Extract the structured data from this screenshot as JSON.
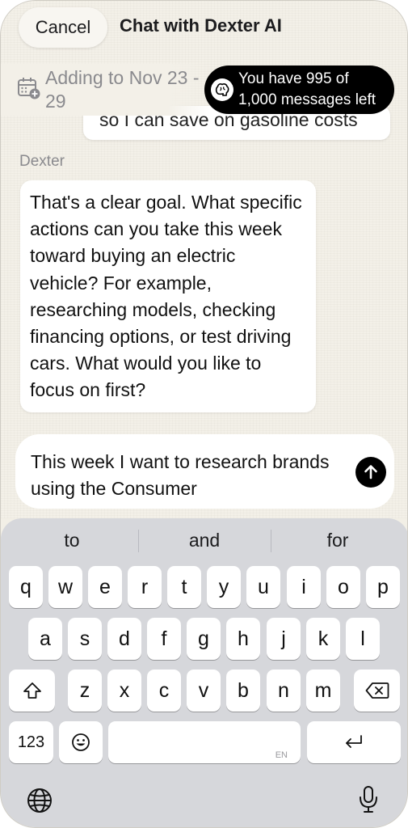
{
  "header": {
    "cancel_label": "Cancel",
    "title": "Chat with Dexter AI"
  },
  "calendar": {
    "icon": "calendar-add-icon",
    "text": "Adding to Nov 23 - 29"
  },
  "quota": {
    "icon": "brain-icon",
    "line1": "You have 995 of",
    "line2": "1,000 messages left"
  },
  "previous_user_message_fragment": "so I can save on gasoline costs",
  "messages": [
    {
      "sender": "Dexter",
      "text": "That's a clear goal. What specific actions can you take this week toward buying an electric vehicle? For example, researching models, checking financing options, or test driving cars. What would you like to focus on first?"
    }
  ],
  "composer": {
    "text": "This week I want to research brands using the Consumer",
    "send_icon": "arrow-up-icon"
  },
  "keyboard": {
    "suggestions": [
      "to",
      "and",
      "for"
    ],
    "row1": [
      "q",
      "w",
      "e",
      "r",
      "t",
      "y",
      "u",
      "i",
      "o",
      "p"
    ],
    "row2": [
      "a",
      "s",
      "d",
      "f",
      "g",
      "h",
      "j",
      "k",
      "l"
    ],
    "row3": [
      "z",
      "x",
      "c",
      "v",
      "b",
      "n",
      "m"
    ],
    "numbers_label": "123",
    "space_locale": "EN",
    "shift_icon": "shift-icon",
    "delete_icon": "delete-icon",
    "emoji_icon": "emoji-icon",
    "return_icon": "return-icon",
    "globe_icon": "globe-icon",
    "mic_icon": "microphone-icon"
  },
  "colors": {
    "accent": "#000000",
    "background": "#f3f0e8",
    "keyboard": "#d6d7db"
  }
}
